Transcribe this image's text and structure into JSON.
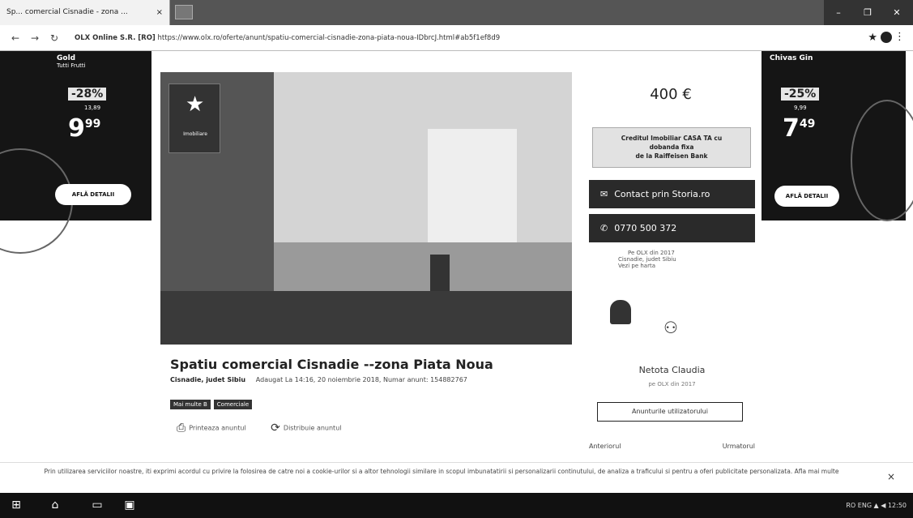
{
  "browser": {
    "tab_title": "Sp... comercial Cisnadie - zona ...",
    "tab_close": "×",
    "nav_back": "←",
    "nav_forward": "→",
    "nav_reload": "↻",
    "url_secure_label": "OLX Online S.R. [RO]",
    "url": "https://www.olx.ro/oferte/anunt/spatiu-comercial-cisnadie-zona-piata-noua-IDbrcJ.html#ab5f1ef8d9",
    "bookmark_icon": "★",
    "menu_icon": "⋮",
    "window_controls": [
      "–",
      "❐",
      "✕"
    ]
  },
  "ad_left": {
    "brand": "Gold",
    "subbrand": "Tutti Frutti",
    "discount": "-28%",
    "old_price": "13,89",
    "price_int": "9",
    "price_dec": "99",
    "cta": "AFLĂ DETALII"
  },
  "ad_right": {
    "brand": "Chivas Gin",
    "discount": "-25%",
    "old_price": "9,99",
    "price_int": "7",
    "price_dec": "49",
    "cta": "AFLĂ DETALII"
  },
  "listing": {
    "photo_logo_text": "Imobiliare",
    "photo_logo_star": "★",
    "title": "Spatiu comercial Cisnadie --zona Piata Noua",
    "location": "Cisnadie, judet Sibiu",
    "meta": "Adaugat La 14:16, 20 noiembrie 2018, Numar anunt: 154882767",
    "tags": [
      "Mai multe B",
      "Comerciale"
    ],
    "action_print": "Printeaza anuntul",
    "action_share": "Distribuie anuntul",
    "price": "400 €",
    "promo_line1": "Creditul Imobiliar CASA TA cu",
    "promo_line2": "dobanda fixa",
    "promo_line3": "de la Raiffeisen Bank",
    "contact_label": "Contact prin Storia.ro",
    "phone_label": "0770 500 372",
    "seller_line1": "Pe OLX din 2017",
    "seller_line2": "Cisnadie, judet Sibiu",
    "seller_line3": "Vezi pe harta",
    "seller_name": "Netota Claudia",
    "seller_since": "pe OLX din 2017",
    "view_all": "Anunturile utilizatorului",
    "prev": "Anteriorul",
    "next": "Urmatorul"
  },
  "cookie": {
    "text": "Prin utilizarea serviciilor noastre, iti exprimi acordul cu privire la folosirea de catre noi a cookie-urilor si a altor tehnologii similare in scopul imbunatatirii si personalizarii continutului, de analiza a traficului si pentru a oferi publicitate personalizata. Afla mai multe",
    "close": "×"
  },
  "taskbar": {
    "start": "⊞",
    "home": "⌂",
    "taskview": "▭",
    "explorer": "▣",
    "tray": "RO  ENG  ▲  ◀  12:50"
  }
}
